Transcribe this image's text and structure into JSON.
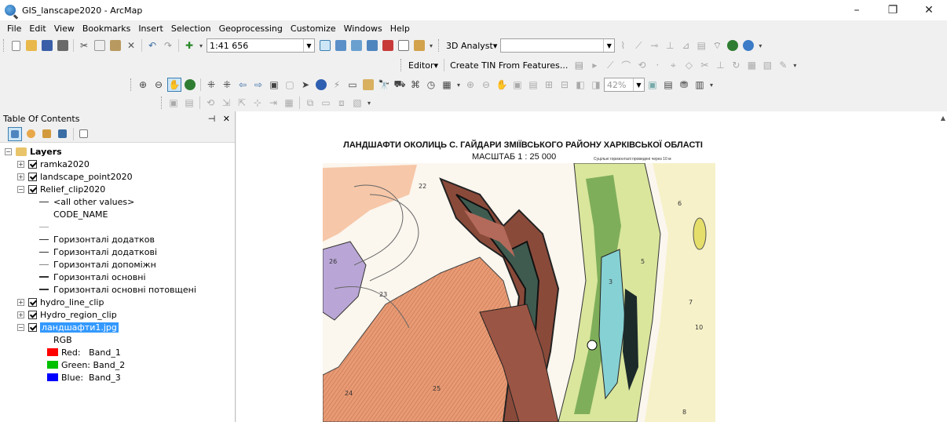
{
  "window": {
    "title": "GIS_lanscape2020 - ArcMap",
    "minimize": "–",
    "maximize": "❐",
    "close": "✕"
  },
  "menu": [
    "File",
    "Edit",
    "View",
    "Bookmarks",
    "Insert",
    "Selection",
    "Geoprocessing",
    "Customize",
    "Windows",
    "Help"
  ],
  "toolbar": {
    "scale_value": "1:41 656",
    "analyst_3d_label": "3D Analyst▾",
    "editor_label": "Editor▾",
    "create_tin_label": "Create TIN From Features...",
    "zoom_percent": "42%"
  },
  "toc": {
    "title": "Table Of Contents",
    "pin_icon": "⊣",
    "close_icon": "✕",
    "root": "Layers",
    "items": [
      {
        "label": "ramka2020",
        "expander": "+"
      },
      {
        "label": "landscape_point2020",
        "expander": "+"
      },
      {
        "label": "Relief_clip2020",
        "expander": "−"
      },
      {
        "label": "<all other values>"
      },
      {
        "label": "CODE_NAME"
      },
      {
        "label": "Горизонталі додатков"
      },
      {
        "label": "Горизонталі додаткові"
      },
      {
        "label": "Горизонталі допоміжн"
      },
      {
        "label": "Горизонталі основні"
      },
      {
        "label": "Горизонталі основні потовщені"
      },
      {
        "label": "hydro_line_clip",
        "expander": "+"
      },
      {
        "label": "Hydro_region_clip",
        "expander": "+"
      },
      {
        "label": "ландшафти1.jpg",
        "expander": "−"
      },
      {
        "label": "RGB"
      },
      {
        "label": "Red:   Band_1",
        "color": "#ff0000"
      },
      {
        "label": "Green: Band_2",
        "color": "#00c000"
      },
      {
        "label": "Blue:  Band_3",
        "color": "#0000ff"
      }
    ]
  },
  "map": {
    "title": "ЛАНДШАФТИ ОКОЛИЦЬ С. ГАЙДАРИ ЗМІЇВСЬКОГО РАЙОНУ ХАРКІВСЬКОЇ ОБЛАСТІ",
    "scale": "МАСШТАБ 1 : 25 000",
    "note": "Суцільні горизонталі проведені через 10 м",
    "labels": [
      "22",
      "23",
      "24",
      "25",
      "26",
      "3",
      "5",
      "6",
      "7",
      "8",
      "10"
    ]
  }
}
